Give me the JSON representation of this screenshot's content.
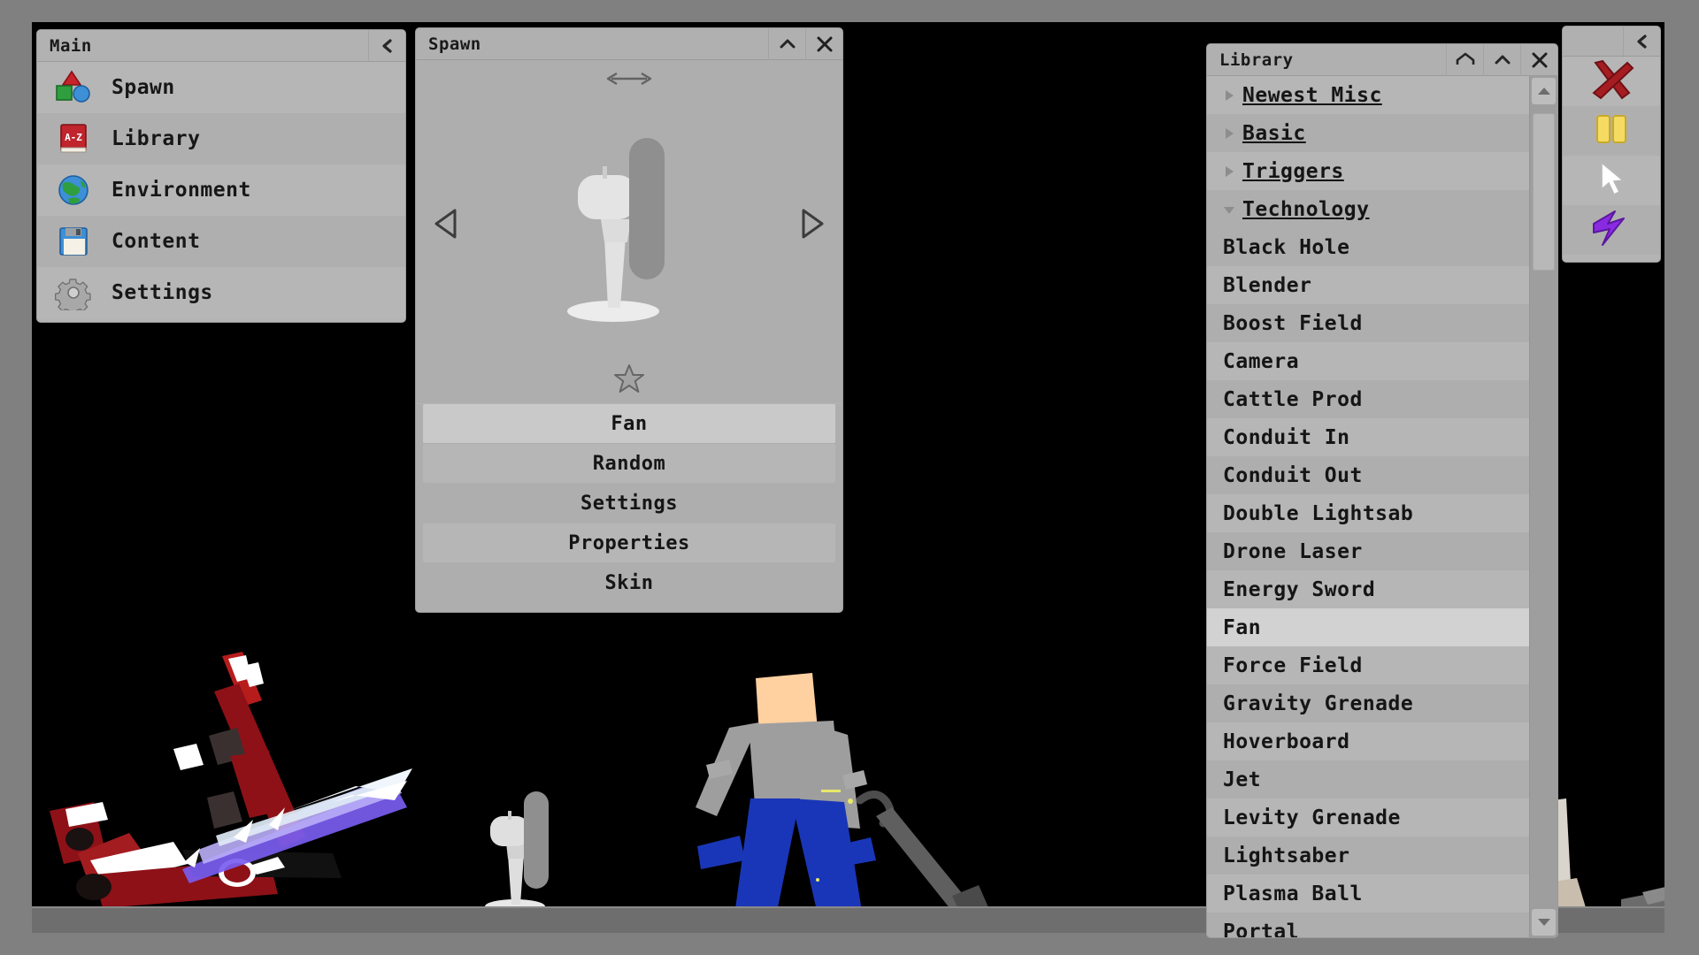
{
  "main_panel": {
    "title": "Main",
    "collapse_icon": "chevron-left-icon",
    "items": [
      {
        "label": "Spawn",
        "icon": "shapes-icon"
      },
      {
        "label": "Library",
        "icon": "book-az-icon"
      },
      {
        "label": "Environment",
        "icon": "globe-icon"
      },
      {
        "label": "Content",
        "icon": "floppy-disk-icon"
      },
      {
        "label": "Settings",
        "icon": "gear-icon"
      }
    ]
  },
  "spawn_panel": {
    "title": "Spawn",
    "collapse_icon": "chevron-up-icon",
    "close_icon": "close-icon",
    "resize_icon": "horizontal-resize-icon",
    "prev_icon": "triangle-left-icon",
    "next_icon": "triangle-right-icon",
    "favorite_icon": "star-icon",
    "preview_item": "fan-preview",
    "buttons": [
      {
        "label": "Fan",
        "state": "selected"
      },
      {
        "label": "Random",
        "state": "normal"
      },
      {
        "label": "Settings",
        "state": "normal"
      },
      {
        "label": "Properties",
        "state": "normal"
      },
      {
        "label": "Skin",
        "state": "normal"
      }
    ]
  },
  "library_panel": {
    "title": "Library",
    "home_icon": "home-icon",
    "collapse_icon": "chevron-up-icon",
    "close_icon": "close-icon",
    "scroll_up_icon": "scroll-up-arrow-icon",
    "scroll_down_icon": "scroll-down-arrow-icon",
    "categories": [
      {
        "label": "Newest Misc",
        "expanded": false,
        "icon": "triangle-right-icon"
      },
      {
        "label": "Basic",
        "expanded": false,
        "icon": "triangle-right-icon"
      },
      {
        "label": "Triggers",
        "expanded": false,
        "icon": "triangle-right-icon"
      },
      {
        "label": "Technology",
        "expanded": true,
        "icon": "triangle-down-icon"
      }
    ],
    "items": [
      {
        "label": "Black Hole",
        "selected": false
      },
      {
        "label": "Blender",
        "selected": false
      },
      {
        "label": "Boost Field",
        "selected": false
      },
      {
        "label": "Camera",
        "selected": false
      },
      {
        "label": "Cattle Prod",
        "selected": false
      },
      {
        "label": "Conduit In",
        "selected": false
      },
      {
        "label": "Conduit Out",
        "selected": false
      },
      {
        "label": "Double Lightsab",
        "selected": false
      },
      {
        "label": "Drone Laser",
        "selected": false
      },
      {
        "label": "Energy Sword",
        "selected": false
      },
      {
        "label": "Fan",
        "selected": true
      },
      {
        "label": "Force Field",
        "selected": false
      },
      {
        "label": "Gravity Grenade",
        "selected": false
      },
      {
        "label": "Hoverboard",
        "selected": false
      },
      {
        "label": "Jet",
        "selected": false
      },
      {
        "label": "Levity Grenade",
        "selected": false
      },
      {
        "label": "Lightsaber",
        "selected": false
      },
      {
        "label": "Plasma Ball",
        "selected": false
      },
      {
        "label": "Portal",
        "selected": false
      }
    ]
  },
  "tools_panel": {
    "collapse_icon": "chevron-left-icon",
    "tools": [
      {
        "name": "delete-tool",
        "icon": "red-x-icon",
        "color": "#a51d21"
      },
      {
        "name": "pause-tool",
        "icon": "yellow-pause-icon",
        "color": "#f5db62"
      },
      {
        "name": "select-tool",
        "icon": "white-cursor-icon",
        "color": "#ffffff"
      },
      {
        "name": "power-tool",
        "icon": "purple-lightning-icon",
        "color": "#8a2be2"
      }
    ]
  },
  "scene": {
    "background_color": "#000000",
    "ground_color": "#6e6e6e",
    "objects": [
      {
        "name": "cattle-prod",
        "colors": [
          "#8e1118",
          "#b71c1c",
          "#8a6aff",
          "#ffffff"
        ]
      },
      {
        "name": "fan",
        "colors": [
          "#e2e2e2",
          "#8c8c8c"
        ]
      },
      {
        "name": "ragdoll-player",
        "colors": [
          "#ffd0a0",
          "#9e9e9e",
          "#1a36b8"
        ]
      },
      {
        "name": "held-tool",
        "colors": [
          "#5a5a5a"
        ]
      }
    ]
  }
}
